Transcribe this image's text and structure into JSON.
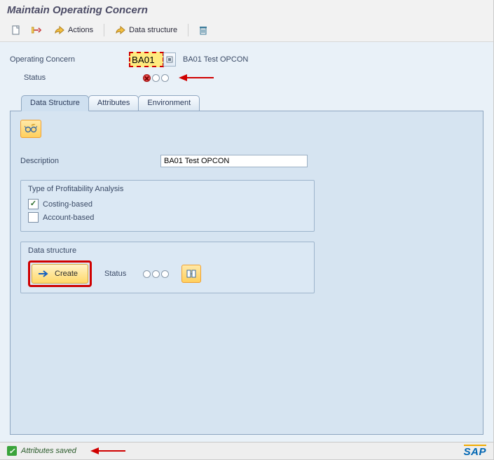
{
  "title": "Maintain Operating Concern",
  "toolbar": {
    "actions_label": "Actions",
    "data_structure_label": "Data structure"
  },
  "fields": {
    "operating_concern_label": "Operating Concern",
    "operating_concern_value": "BA01",
    "operating_concern_text": "BA01 Test OPCON",
    "status_label": "Status"
  },
  "tabs": [
    {
      "label": "Data Structure",
      "active": true
    },
    {
      "label": "Attributes",
      "active": false
    },
    {
      "label": "Environment",
      "active": false
    }
  ],
  "pane": {
    "description_label": "Description",
    "description_value": "BA01 Test OPCON",
    "type_group_title": "Type of Profitability Analysis",
    "costing_based_label": "Costing-based",
    "costing_based_checked": true,
    "account_based_label": "Account-based",
    "account_based_checked": false,
    "ds_group_title": "Data structure",
    "create_label": "Create",
    "ds_status_label": "Status"
  },
  "statusbar": {
    "message": "Attributes saved"
  }
}
